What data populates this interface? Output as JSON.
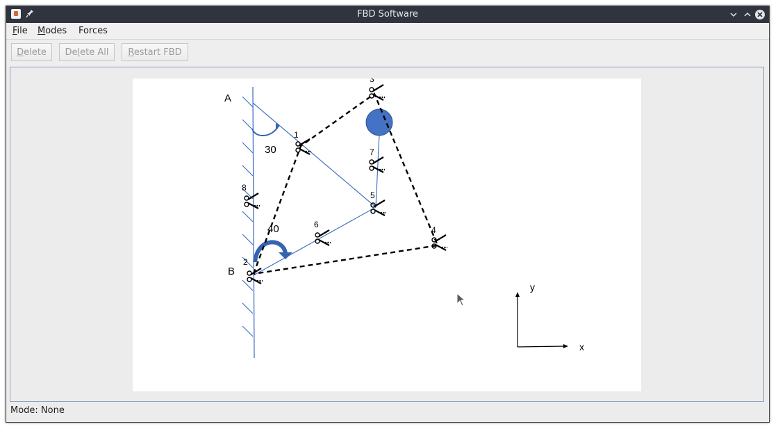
{
  "window": {
    "title": "FBD Software",
    "buttons": [
      "minimize-icon",
      "maximize-icon",
      "close-icon"
    ]
  },
  "menu": {
    "file": {
      "mnemonic": "F",
      "rest": "ile"
    },
    "modes": {
      "mnemonic": "M",
      "rest": "odes"
    },
    "forces": {
      "label": "Forces"
    }
  },
  "toolbar": {
    "delete_mnemonic": "D",
    "delete_rest": "elete",
    "delete_all_pre": "De",
    "delete_all_mnemonic": "l",
    "delete_all_rest": "ete All",
    "restart_mnemonic": "R",
    "restart_rest": "estart FBD"
  },
  "diagram": {
    "point_a": "A",
    "point_b": "B",
    "angle_top": "30",
    "angle_bottom": "40",
    "node_labels": [
      "1",
      "2",
      "3",
      "4",
      "5",
      "6",
      "7",
      "8"
    ],
    "axis_x": "x",
    "axis_y": "y",
    "colors": {
      "member": "#4472c4",
      "moment_arrow": "#3563b0",
      "ball": "#4472c4",
      "dashed_cut": "#000000"
    }
  },
  "status": {
    "label": "Mode: None"
  }
}
